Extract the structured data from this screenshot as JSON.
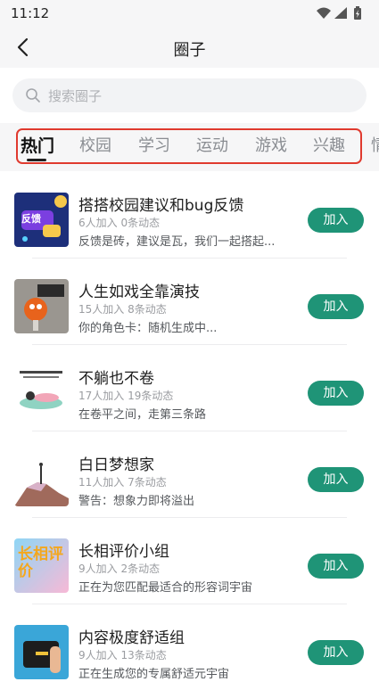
{
  "status_bar": {
    "time": "11:12"
  },
  "header": {
    "title": "圈子"
  },
  "search": {
    "placeholder": "搜索圈子"
  },
  "tabs": [
    {
      "label": "热门"
    },
    {
      "label": "校园"
    },
    {
      "label": "学习"
    },
    {
      "label": "运动"
    },
    {
      "label": "游戏"
    },
    {
      "label": "兴趣"
    },
    {
      "label": "情"
    }
  ],
  "colors": {
    "accent": "#1f9477",
    "highlight": "#e03a2f"
  },
  "circles": [
    {
      "name": "搭搭校园建议和bug反馈",
      "meta": "6人加入  0条动态",
      "desc": "反馈是砖，建议是瓦，我们一起搭起...",
      "join": "加入",
      "thumb_text": "反馈"
    },
    {
      "name": "人生如戏全靠演技",
      "meta": "15人加入  8条动态",
      "desc": "你的角色卡：随机生成中...",
      "join": "加入",
      "thumb_text": ""
    },
    {
      "name": "不躺也不卷",
      "meta": "17人加入  19条动态",
      "desc": "在卷平之间，走第三条路",
      "join": "加入",
      "thumb_text": ""
    },
    {
      "name": "白日梦想家",
      "meta": "11人加入  7条动态",
      "desc": "警告：想象力即将溢出",
      "join": "加入",
      "thumb_text": ""
    },
    {
      "name": "长相评价小组",
      "meta": "9人加入  2条动态",
      "desc": "正在为您匹配最适合的形容词宇宙",
      "join": "加入",
      "thumb_text": "长相评价"
    },
    {
      "name": "内容极度舒适组",
      "meta": "9人加入  13条动态",
      "desc": "正在生成您的专属舒适元宇宙",
      "join": "加入",
      "thumb_text": ""
    }
  ]
}
